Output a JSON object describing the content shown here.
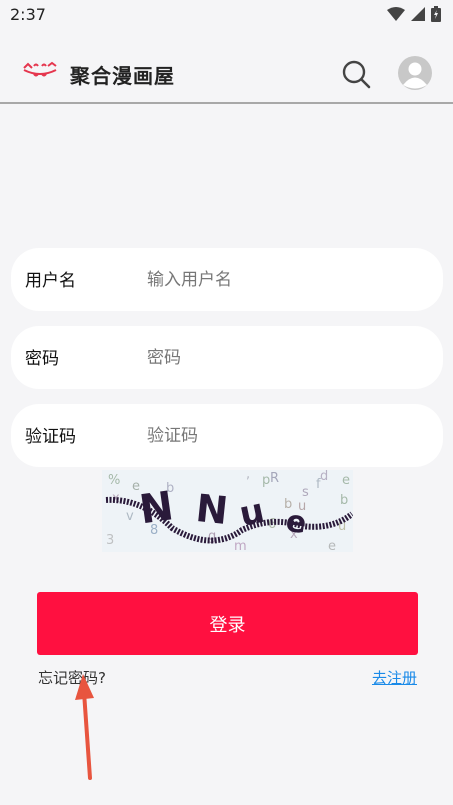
{
  "status_bar": {
    "time": "2:37"
  },
  "header": {
    "title": "聚合漫画屋"
  },
  "form": {
    "username": {
      "label": "用户名",
      "placeholder": "输入用户名"
    },
    "password": {
      "label": "密码",
      "placeholder": "密码"
    },
    "captcha": {
      "label": "验证码",
      "placeholder": "验证码"
    },
    "captcha_text": "NNue"
  },
  "actions": {
    "login_label": "登录",
    "forgot_label": "忘记密码?",
    "register_label": "去注册"
  },
  "colors": {
    "accent": "#ff1040",
    "link": "#1a8ae8",
    "background": "#f5f5f7",
    "annotation": "#e8553f"
  }
}
